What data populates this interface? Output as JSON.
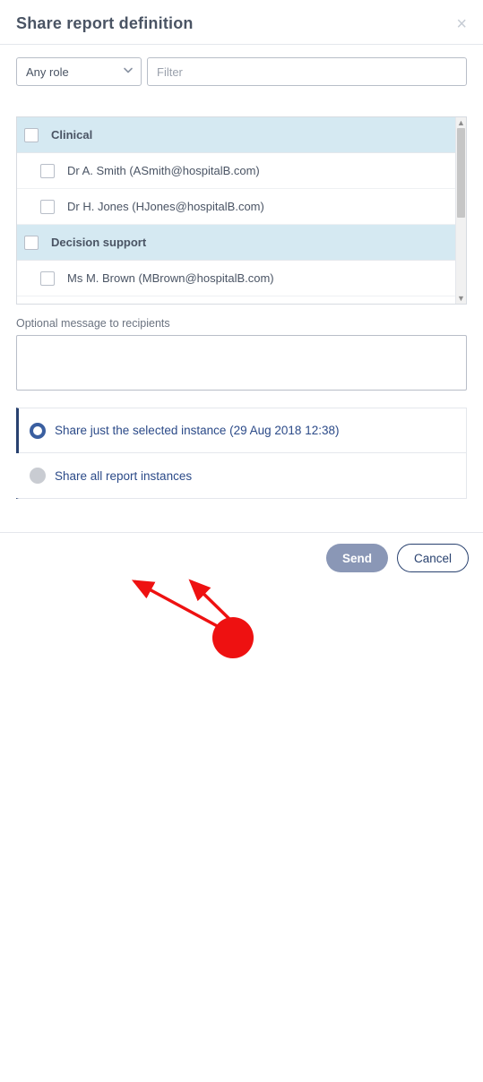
{
  "header": {
    "title": "Share report definition"
  },
  "filters": {
    "role_select": {
      "value": "Any role"
    },
    "filter_input": {
      "placeholder": "Filter",
      "value": ""
    }
  },
  "list": {
    "groups": [
      {
        "name": "Clinical",
        "items": [
          "Dr A. Smith (ASmith@hospitalB.com)",
          "Dr H. Jones (HJones@hospitalB.com)"
        ]
      },
      {
        "name": "Decision support",
        "items": [
          "Ms M. Brown (MBrown@hospitalB.com)"
        ]
      }
    ]
  },
  "message": {
    "label": "Optional message to recipients",
    "value": ""
  },
  "options": {
    "selected": "Share just the selected instance (29 Aug 2018 12:38)",
    "all": "Share all report instances"
  },
  "footer": {
    "send": "Send",
    "cancel": "Cancel"
  },
  "colors": {
    "accent": "#28416f",
    "group_bg": "#d5e9f2",
    "annotation": "#e11"
  }
}
